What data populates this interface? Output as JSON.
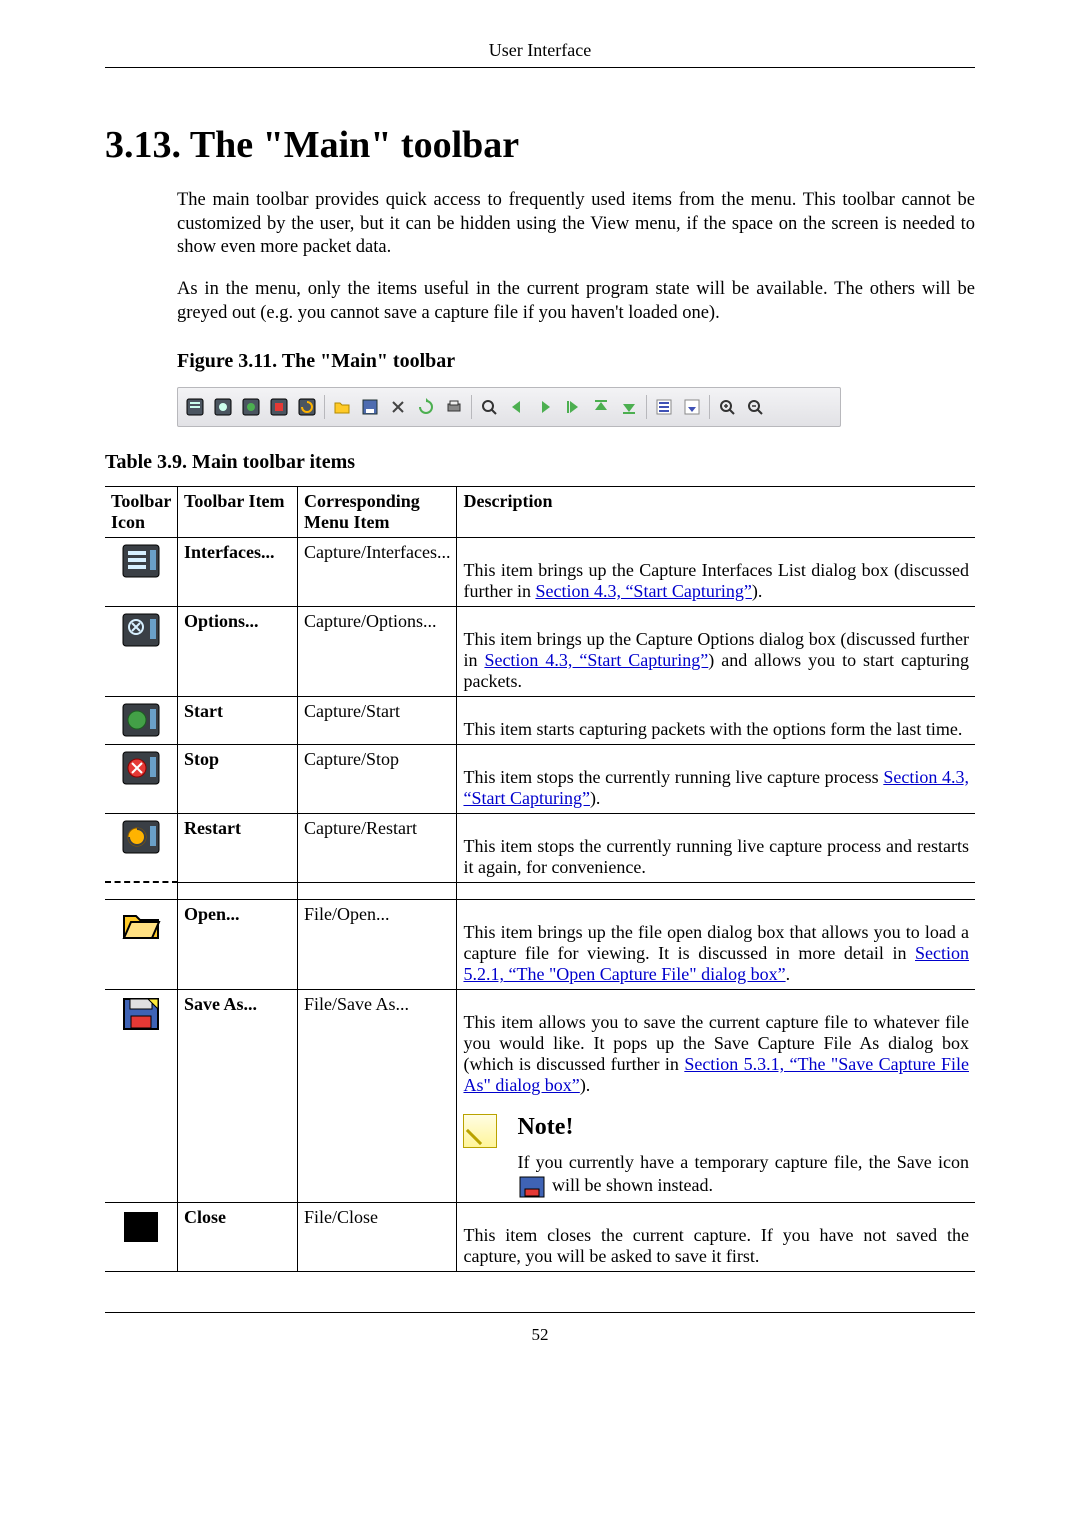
{
  "running_head": "User Interface",
  "section_title": "3.13. The \"Main\" toolbar",
  "para1": "The main toolbar provides quick access to frequently used items from the menu. This toolbar cannot be customized by the user, but it can be hidden using the View menu, if the space on the screen is needed to show even more packet data.",
  "para2": "As in the menu, only the items useful in the current program state will be available. The others will be greyed out (e.g. you cannot save a capture file if you haven't loaded one).",
  "fig_caption": "Figure 3.11. The \"Main\" toolbar",
  "tbl_caption": "Table 3.9. Main toolbar items",
  "headers": {
    "icon": "Toolbar Icon",
    "item": "Toolbar Item",
    "menu": "Corresponding Menu Item",
    "desc": "Description"
  },
  "rows": {
    "interfaces": {
      "item": "Interfaces...",
      "menu": "Capture/Interfaces...",
      "desc_a": "This item brings up the Capture Interfaces List dialog box (discussed further in ",
      "link1": "Section 4.3, “Start Capturing”",
      "desc_b": ")."
    },
    "options": {
      "item": "Options...",
      "menu": "Capture/Options...",
      "desc_a": "This item brings up the Capture Options dialog box (discussed further in ",
      "link1": "Section 4.3, “Start Capturing”",
      "desc_b": ") and allows you to start capturing packets."
    },
    "start": {
      "item": "Start",
      "menu": "Capture/Start",
      "desc": "This item starts capturing packets with the options form the last time."
    },
    "stop": {
      "item": "Stop",
      "menu": "Capture/Stop",
      "desc_a": "This item stops the currently running live capture process ",
      "link1": "Section 4.3, “Start Capturing”",
      "desc_b": ")."
    },
    "restart": {
      "item": "Restart",
      "menu": "Capture/Restart",
      "desc": "This item stops the currently running live capture process and restarts it again, for convenience."
    },
    "open": {
      "item": "Open...",
      "menu": "File/Open...",
      "desc_a": "This item brings up the file open dialog box that allows you to load a capture file for viewing. It is discussed in more detail in ",
      "link1": "Section 5.2.1, “The \"Open Capture File\" dialog box”",
      "desc_b": "."
    },
    "saveas": {
      "item": "Save As...",
      "menu": "File/Save As...",
      "desc_a": "This item allows you to save the current capture file to whatever file you would like. It pops up the Save Capture File As dialog box (which is discussed further in ",
      "link1": "Section 5.3.1, “The \"Save Capture File As\" dialog box”",
      "desc_b": ").",
      "note_title": "Note!",
      "note_a": "If you currently have a temporary capture file, the Save icon ",
      "note_b": " will be shown instead."
    },
    "close": {
      "item": "Close",
      "menu": "File/Close",
      "desc": "This item closes the current capture. If you have not saved the capture, you will be asked to save it first."
    }
  },
  "page_number": "52"
}
